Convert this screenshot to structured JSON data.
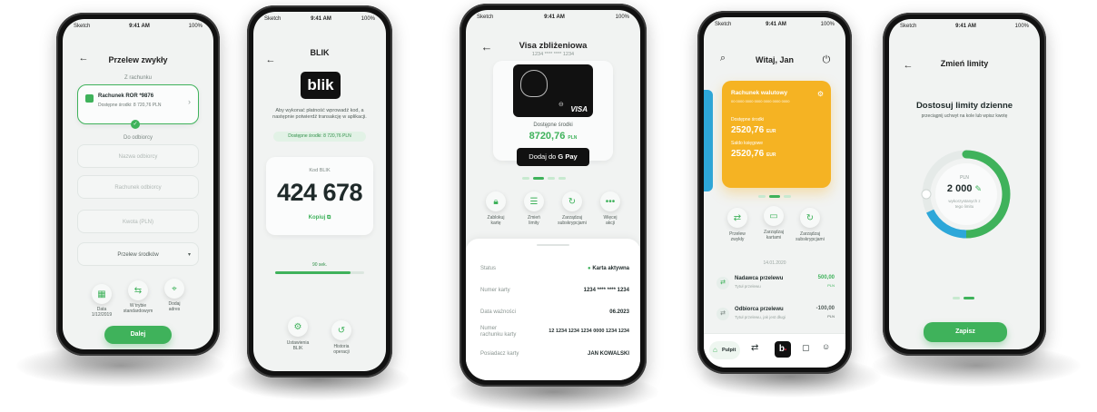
{
  "status_bar": {
    "carrier": "Sketch",
    "time": "9:41 AM",
    "battery": "100%"
  },
  "phone1": {
    "title": "Przelew zwykły",
    "section_from": "Z rachunku",
    "account_name": "Rachunek ROR *9876",
    "account_balance": "Dostępne środki: 8 720,76 PLN",
    "section_to": "Do odbiorcy",
    "field_recipient": "Nazwa odbiorcy",
    "field_account": "Rachunek odbiorcy",
    "field_amount": "Kwota (PLN)",
    "dropdown_label": "Przelew środków",
    "opt_date_label": "Data",
    "opt_date_value": "1/12/2019",
    "opt_mode_label": "W trybie",
    "opt_mode_value": "standardowym",
    "opt_address_label": "Dodaj",
    "opt_address_value": "adres",
    "next_button": "Dalej"
  },
  "phone2": {
    "title": "BLIK",
    "logo_text": "blik",
    "instructions": "Aby wykonać płatność wprowadź kod, a następnie potwierdź transakcję w aplikacji.",
    "balance": "Dostępne środki: 8 720,76 PLN",
    "code_label": "Kod BLIK",
    "code": "424 678",
    "copy_label": "Kopiuj",
    "timer": "90 sek.",
    "timer_fraction": 0.85,
    "action1_line1": "Ustawienia",
    "action1_line2": "BLIK",
    "action2_line1": "Historia",
    "action2_line2": "operacji"
  },
  "phone3": {
    "title": "Visa zbliżeniowa",
    "card_number_masked": "1234 **** **** 1234",
    "card_brand": "VISA",
    "available_label": "Dostępne środki",
    "available_value": "8720,76",
    "currency": "PLN",
    "gpay_text": "Dodaj do",
    "gpay_brand": "G Pay",
    "action_lock_1": "Zablokuj",
    "action_lock_2": "kartę",
    "action_limits_1": "Zmień",
    "action_limits_2": "limity",
    "action_manage_1": "Zarządzaj",
    "action_manage_2": "subskrypcjami",
    "action_more_1": "Więcej",
    "action_more_2": "akcji",
    "rows": [
      {
        "label": "Status",
        "value": "Karta aktywna"
      },
      {
        "label": "Numer karty",
        "value": "1234 **** **** 1234"
      },
      {
        "label": "Data ważności",
        "value": "06.2023"
      },
      {
        "label": "Numer rachunku karty",
        "value": "12 1234 1234 1234 0000 1234 1234"
      },
      {
        "label": "Posiadacz karty",
        "value": "JAN KOWALSKI"
      }
    ]
  },
  "phone4": {
    "title": "Witaj, Jan",
    "account_title": "Rachunek walutowy",
    "account_number": "00 0000 0000 0000 0000 0000 0000",
    "available_label": "Dostępne środki",
    "available_value": "2520,76",
    "available_currency": "EUR",
    "booked_label": "Saldo księgowe",
    "booked_value": "2520,76",
    "booked_currency": "EUR",
    "action_transfer_1": "Przelew",
    "action_transfer_2": "zwykły",
    "action_cards_1": "Zarządzaj",
    "action_cards_2": "kartami",
    "action_subs_1": "Zarządzaj",
    "action_subs_2": "subskrypcjami",
    "date_sep": "14.01.2020",
    "tx1_title": "Nadawca przelewu",
    "tx1_sub": "Tytuł przelewu",
    "tx1_amount": "500,00",
    "tx1_currency": "PLN",
    "tx2_title": "Odbiorca przelewu",
    "tx2_sub": "Tytuł przelewu, jak jest długi",
    "tx2_amount": "-100,00",
    "tx2_currency": "PLN",
    "nav_home": "Pulpit"
  },
  "phone5": {
    "title": "Zmień limity",
    "heading": "Dostosuj limity dzienne",
    "sub": "przeciągnij uchwyt na kole lub wpisz kwotę",
    "currency": "PLN",
    "amount": "2 000",
    "caption": "wykorzystanych z ",
    "caption_line2": "tego limitu",
    "save_button": "Zapisz",
    "limit_fraction": 0.4
  },
  "colors": {
    "green": "#3fb25b",
    "yellow": "#f5b323",
    "blue": "#2da7d9",
    "blik_red": "#e5173f"
  }
}
